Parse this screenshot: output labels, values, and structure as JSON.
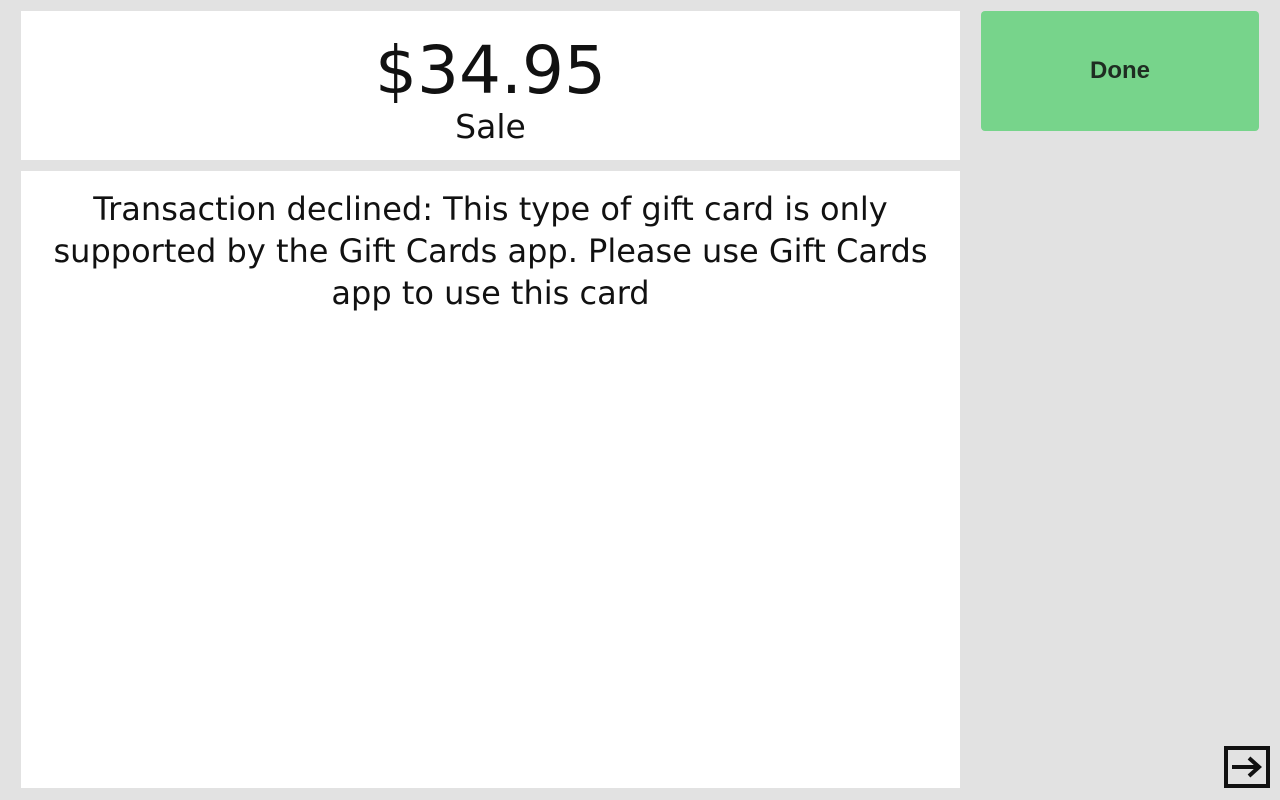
{
  "transaction": {
    "amount": "$34.95",
    "type": "Sale"
  },
  "message": {
    "text": "Transaction declined: This type of gift card is only supported by the Gift Cards app. Please use Gift Cards app to use this card"
  },
  "actions": {
    "done_label": "Done",
    "exit_icon": "exit-icon"
  },
  "colors": {
    "background": "#e2e2e2",
    "panel": "#ffffff",
    "done_button": "#77d48b",
    "text": "#111111"
  }
}
